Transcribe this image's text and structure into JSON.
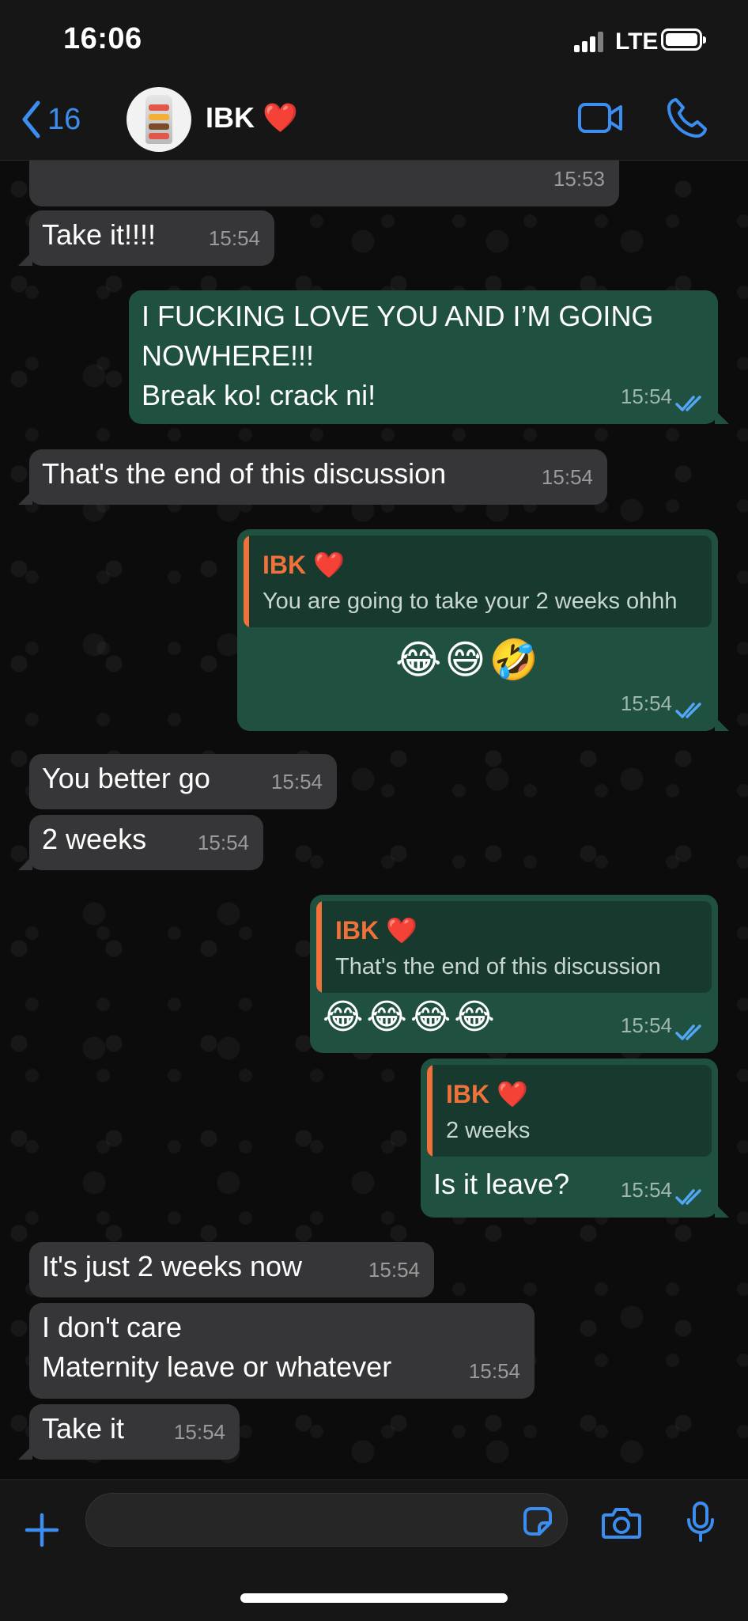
{
  "status_bar": {
    "time": "16:06",
    "network": "LTE"
  },
  "header": {
    "back_count": "16",
    "contact_name": "IBK ❤️"
  },
  "messages": [
    {
      "dir": "in",
      "text": "",
      "time": "15:53"
    },
    {
      "dir": "in",
      "text": "Take it!!!!",
      "time": "15:54"
    },
    {
      "dir": "out",
      "text": "I FUCKING LOVE YOU AND I’M GOING\nNOWHERE!!!\nBreak ko! crack ni!",
      "time": "15:54",
      "status": "read"
    },
    {
      "dir": "in",
      "text": "That's the end of this discussion",
      "time": "15:54"
    },
    {
      "dir": "out",
      "quote": {
        "author": "IBK ❤️",
        "text": "You are going to take your 2 weeks ohhh"
      },
      "text": "😂😅🤣",
      "time": "15:54",
      "status": "read"
    },
    {
      "dir": "in",
      "text": "You better go",
      "time": "15:54"
    },
    {
      "dir": "in",
      "text": "2 weeks",
      "time": "15:54"
    },
    {
      "dir": "out",
      "quote": {
        "author": "IBK ❤️",
        "text": "That's the end of this discussion"
      },
      "text": "😂😂😂😂",
      "time": "15:54",
      "status": "read"
    },
    {
      "dir": "out",
      "quote": {
        "author": "IBK ❤️",
        "text": "2 weeks"
      },
      "text": "Is it leave?",
      "time": "15:54",
      "status": "read"
    },
    {
      "dir": "in",
      "text": "It's just 2 weeks now",
      "time": "15:54"
    },
    {
      "dir": "in",
      "text": "I don't care\nMaternity leave or whatever",
      "time": "15:54"
    },
    {
      "dir": "in",
      "text": "Take it",
      "time": "15:54"
    }
  ],
  "composer": {
    "placeholder": ""
  },
  "colors": {
    "accent": "#3b8ef0",
    "incoming": "#363638",
    "outgoing": "#1f5040",
    "quote_name": "#f0723a",
    "read_tick": "#53a6f5"
  }
}
